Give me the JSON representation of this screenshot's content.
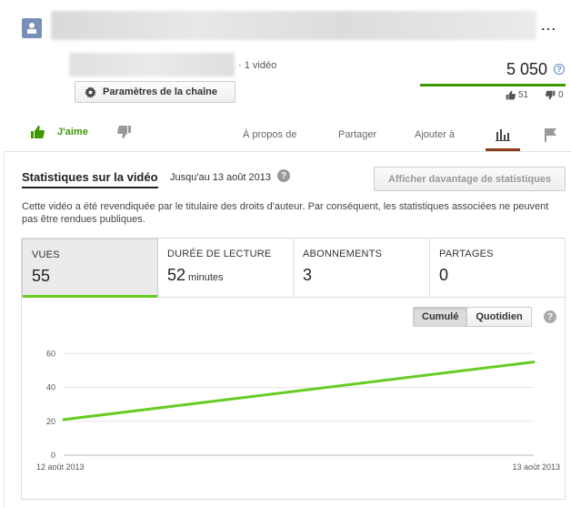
{
  "header": {
    "video_count": "· 1 vidéo",
    "channel_settings_label": "Paramètres de la chaîne",
    "views": "5 050",
    "likes": "51",
    "dislikes": "0"
  },
  "actions": {
    "like_label": "J'aime",
    "tabs": [
      "À propos de",
      "Partager",
      "Ajouter à"
    ]
  },
  "stats": {
    "title": "Statistiques sur la vidéo",
    "date_range": "Jusqu'au 13 août 2013",
    "more_button": "Afficher davantage de statistiques",
    "notice": "Cette vidéo a été revendiquée par le titulaire des droits d'auteur. Par conséquent, les statistiques associées ne peuvent pas être rendues publiques.",
    "metrics": [
      {
        "label": "VUES",
        "value": "55",
        "unit": ""
      },
      {
        "label": "DURÉE DE LECTURE",
        "value": "52",
        "unit": "minutes"
      },
      {
        "label": "ABONNEMENTS",
        "value": "3",
        "unit": ""
      },
      {
        "label": "PARTAGES",
        "value": "0",
        "unit": ""
      }
    ],
    "toggle": {
      "cumulative": "Cumulé",
      "daily": "Quotidien"
    }
  },
  "colors": {
    "accent_green": "#66cc22",
    "like_green": "#3c9a00",
    "active_tab": "#8b3a1a"
  },
  "chart_data": {
    "type": "line",
    "x": [
      "12 août 2013",
      "13 août 2013"
    ],
    "series": [
      {
        "values": [
          21,
          55
        ]
      }
    ],
    "ylim": [
      0,
      65
    ],
    "yticks": [
      0,
      20,
      40,
      60
    ],
    "xtick_labels": [
      "12 août 2013",
      "13 août 2013"
    ],
    "color": "#66cc22",
    "grid": true
  }
}
